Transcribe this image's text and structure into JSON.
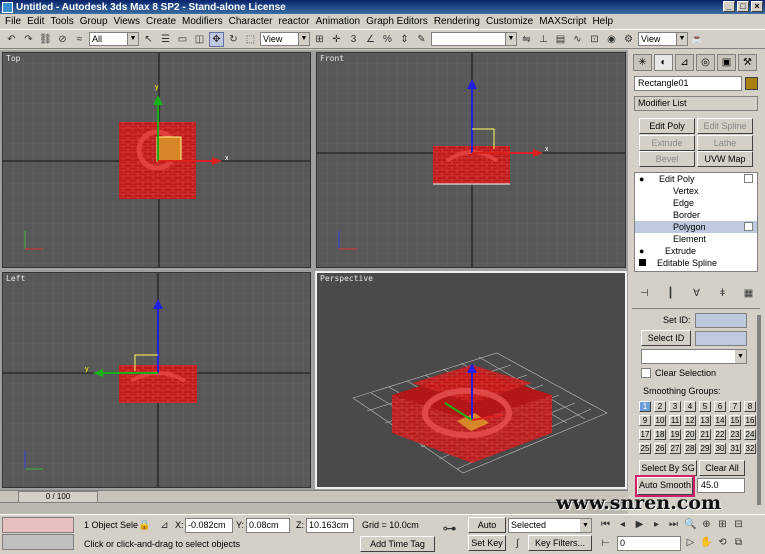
{
  "window": {
    "title": "Untitled - Autodesk 3ds Max 8 SP2 - Stand-alone License",
    "minimize": "_",
    "maximize": "□",
    "close": "×"
  },
  "menu": [
    "File",
    "Edit",
    "Tools",
    "Group",
    "Views",
    "Create",
    "Modifiers",
    "Character",
    "reactor",
    "Animation",
    "Graph Editors",
    "Rendering",
    "Customize",
    "MAXScript",
    "Help"
  ],
  "toolbar": {
    "selection_filter": "All",
    "ref_coord": "View",
    "named_selection": "",
    "view_right": "View"
  },
  "viewports": {
    "top": "Top",
    "front": "Front",
    "left": "Left",
    "perspective": "Perspective"
  },
  "axes": {
    "x": "x",
    "y": "y"
  },
  "command_panel": {
    "object_name": "Rectangle01",
    "modifier_list": "Modifier List",
    "buttons": {
      "edit_poly": "Edit Poly",
      "edit_spline": "Edit Spline",
      "extrude": "Extrude",
      "lathe": "Lathe",
      "bevel": "Bevel",
      "uvw_map": "UVW Map"
    },
    "stack": [
      "Edit Poly",
      "Vertex",
      "Edge",
      "Border",
      "Polygon",
      "Element",
      "Extrude",
      "Editable Spline"
    ],
    "set_id": "Set ID:",
    "select_id": "Select ID",
    "clear_selection": "Clear Selection",
    "smoothing_groups": "Smoothing Groups:",
    "smoothing_cells": [
      "1",
      "2",
      "3",
      "4",
      "5",
      "6",
      "7",
      "8",
      "9",
      "10",
      "11",
      "12",
      "13",
      "14",
      "15",
      "16",
      "17",
      "18",
      "19",
      "20",
      "21",
      "22",
      "23",
      "24",
      "25",
      "26",
      "27",
      "28",
      "29",
      "30",
      "31",
      "32"
    ],
    "select_by_sg": "Select By SG",
    "clear_all": "Clear All",
    "auto_smooth": "Auto Smooth",
    "auto_smooth_value": "45.0"
  },
  "timeline": {
    "frame": "0 / 100"
  },
  "status": {
    "selection": "1 Object Sele",
    "prompt": "Click or click-and-drag to select objects",
    "x_label": "X:",
    "x": "-0.082cm",
    "y_label": "Y:",
    "y": "0.08cm",
    "z_label": "Z:",
    "z": "10.163cm",
    "grid": "Grid = 10.0cm",
    "add_time_tag": "Add Time Tag",
    "auto_key": "Auto Key",
    "set_key": "Set Key",
    "key_mode": "Selected",
    "key_filters": "Key Filters...",
    "frame_field": "0"
  },
  "watermark": "www.snren.com"
}
